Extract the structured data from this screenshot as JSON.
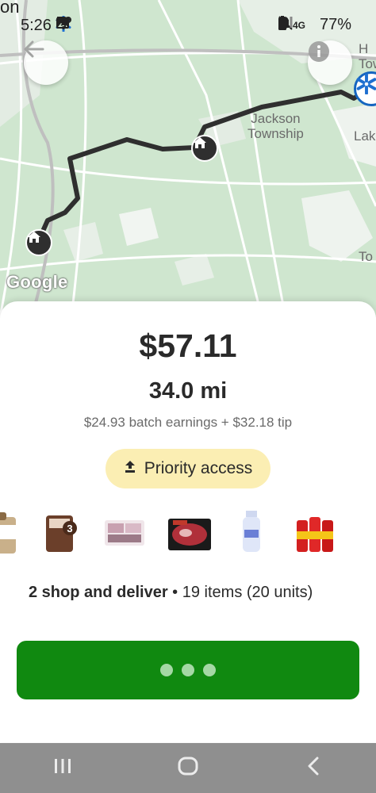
{
  "status_bar": {
    "time": "5:26",
    "network": "4G",
    "battery": "77%",
    "icons_left": [
      "walmart-spark-icon",
      "image-icon",
      "wifi-icon",
      "location-signal-icon"
    ],
    "icons_right": [
      "mute-icon",
      "location-icon",
      "network-icon",
      "signal-icon",
      "battery-icon"
    ]
  },
  "map": {
    "corner_text": "on",
    "labels": {
      "jackson_township": "Jackson\nTownship",
      "top_right": "H\nTow",
      "lake": "Lak",
      "to": "To"
    },
    "google_attribution": "Google",
    "colors": {
      "land": "#cfe6cf",
      "route": "#2f2f2f",
      "road": "#ffffff"
    }
  },
  "offer": {
    "price": "$57.11",
    "distance": "34.0 mi",
    "earnings_breakdown": "$24.93 batch earnings + $32.18 tip",
    "priority_label": "Priority access",
    "products": [
      "coffee-creamer",
      "ice-cream-bars",
      "cat-food-pack",
      "steak-pack",
      "body-wash-bottle",
      "sports-drink-pack"
    ],
    "summary_strong": "2 shop and deliver",
    "summary_separator": " • ",
    "summary_rest": "19 items (20 units)",
    "accept_button_state": "loading",
    "accent_color": "#108910",
    "badge_color": "#fbeeb3"
  },
  "nav": {
    "buttons": [
      "recent-apps-icon",
      "home-icon",
      "back-chevron-icon"
    ]
  }
}
